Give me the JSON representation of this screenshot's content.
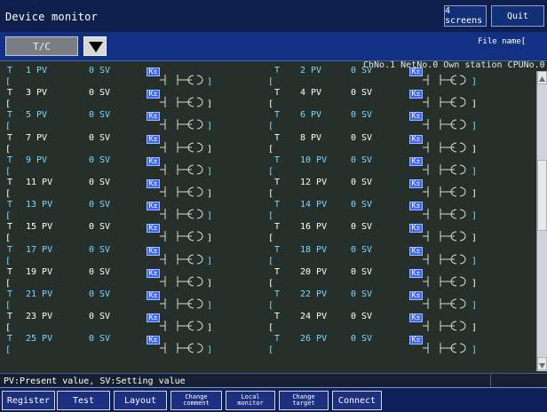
{
  "window": {
    "title": "Device monitor"
  },
  "top_buttons": {
    "screens": "4 screens",
    "quit": "Quit"
  },
  "toolbar": {
    "device_select": "T/C",
    "file_name_label": "File name[",
    "file_name_close": "]"
  },
  "info": {
    "station": "ChNo.1 NetNo.0 Own station CPUNo.0"
  },
  "rows": [
    {
      "left": {
        "pv": "1 PV",
        "sv": "0 SV"
      },
      "right": {
        "pv": "2 PV",
        "sv": "0 SV"
      },
      "odd": true
    },
    {
      "left": {
        "pv": "3 PV",
        "sv": "0 SV"
      },
      "right": {
        "pv": "4 PV",
        "sv": "0 SV"
      },
      "odd": false
    },
    {
      "left": {
        "pv": "5 PV",
        "sv": "0 SV"
      },
      "right": {
        "pv": "6 PV",
        "sv": "0 SV"
      },
      "odd": true
    },
    {
      "left": {
        "pv": "7 PV",
        "sv": "0 SV"
      },
      "right": {
        "pv": "8 PV",
        "sv": "0 SV"
      },
      "odd": false
    },
    {
      "left": {
        "pv": "9 PV",
        "sv": "0 SV"
      },
      "right": {
        "pv": "10 PV",
        "sv": "0 SV"
      },
      "odd": true
    },
    {
      "left": {
        "pv": "11 PV",
        "sv": "0 SV"
      },
      "right": {
        "pv": "12 PV",
        "sv": "0 SV"
      },
      "odd": false
    },
    {
      "left": {
        "pv": "13 PV",
        "sv": "0 SV"
      },
      "right": {
        "pv": "14 PV",
        "sv": "0 SV"
      },
      "odd": true
    },
    {
      "left": {
        "pv": "15 PV",
        "sv": "0 SV"
      },
      "right": {
        "pv": "16 PV",
        "sv": "0 SV"
      },
      "odd": false
    },
    {
      "left": {
        "pv": "17 PV",
        "sv": "0 SV"
      },
      "right": {
        "pv": "18 PV",
        "sv": "0 SV"
      },
      "odd": true
    },
    {
      "left": {
        "pv": "19 PV",
        "sv": "0 SV"
      },
      "right": {
        "pv": "20 PV",
        "sv": "0 SV"
      },
      "odd": false
    },
    {
      "left": {
        "pv": "21 PV",
        "sv": "0 SV"
      },
      "right": {
        "pv": "22 PV",
        "sv": "0 SV"
      },
      "odd": true
    },
    {
      "left": {
        "pv": "23 PV",
        "sv": "0 SV"
      },
      "right": {
        "pv": "24 PV",
        "sv": "0 SV"
      },
      "odd": false
    },
    {
      "left": {
        "pv": "25 PV",
        "sv": "0 SV"
      },
      "right": {
        "pv": "26 PV",
        "sv": "0 SV"
      },
      "odd": true
    }
  ],
  "cell_texts": {
    "device_prefix": "T",
    "bracket_open": "[",
    "bracket_close": "]",
    "contact_label": "K±"
  },
  "legend": {
    "text": "PV:Present value, SV:Setting value"
  },
  "bottom_buttons": [
    {
      "label": "Register"
    },
    {
      "label": "Test"
    },
    {
      "label": "Layout"
    },
    {
      "label": "Change\ncomment"
    },
    {
      "label": "Local\nmonitor"
    },
    {
      "label": "Change\ntarget"
    },
    {
      "label": "Connect"
    }
  ],
  "colors": {
    "title_bg": "#0d1f4a",
    "toolbar_bg": "#133182",
    "grid_bg": "#26302a",
    "odd_text": "#7fd7ff",
    "even_text": "#ffffff",
    "contact_blue": "#3a67ff"
  },
  "icons": {
    "dropdown": "triangle-down-icon",
    "scroll_up": "scroll-up-icon",
    "scroll_down": "scroll-down-icon",
    "coil": "coil-icon"
  }
}
